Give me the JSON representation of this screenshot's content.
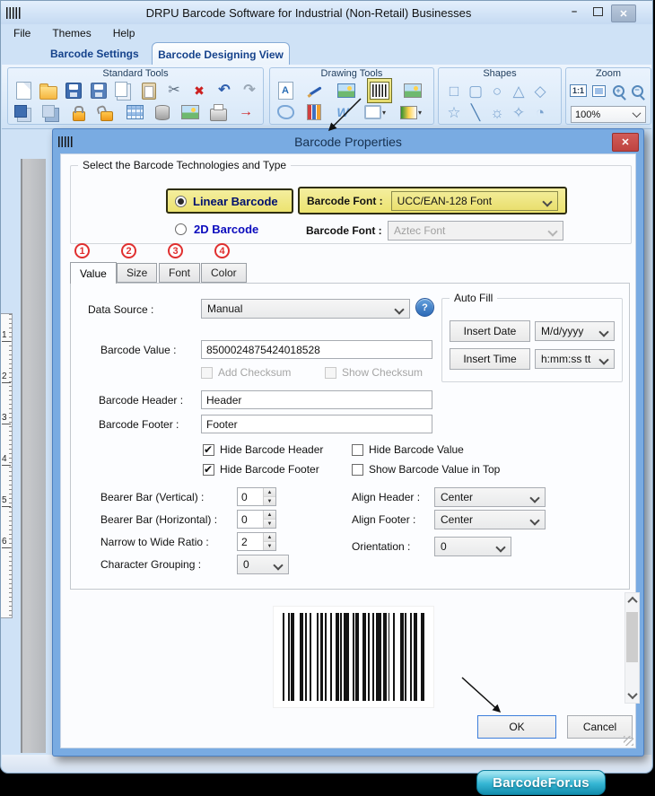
{
  "window": {
    "title": "DRPU Barcode Software for Industrial (Non-Retail) Businesses"
  },
  "menubar": {
    "items": [
      "File",
      "Themes",
      "Help"
    ]
  },
  "doc_tabs": {
    "settings": "Barcode Settings",
    "designing": "Barcode Designing View"
  },
  "ribbon": {
    "standard": {
      "label": "Standard Tools",
      "icons_row1": [
        "new-document",
        "open-file",
        "save",
        "save-as",
        "copy",
        "paste",
        "cut",
        "delete",
        "undo",
        "redo"
      ],
      "icons_row2": [
        "bring-to-front",
        "send-to-back",
        "lock",
        "unlock",
        "grid",
        "database",
        "export-image",
        "print",
        "exit"
      ]
    },
    "drawing": {
      "label": "Drawing Tools",
      "icons_row1": [
        "text-tool",
        "pencil-tool",
        "image-tool",
        "barcode-tool",
        "picture-tool"
      ],
      "icons_row2": [
        "autoshape-tool",
        "library-tool",
        "watermark-tool",
        "frame-tool",
        "gradient-tool"
      ]
    },
    "shapes": {
      "label": "Shapes",
      "icons_row1": [
        "rectangle",
        "rounded-rectangle",
        "ellipse",
        "triangle",
        "diamond"
      ],
      "icons_row2": [
        "star",
        "line",
        "starburst",
        "four-point-star",
        "pie"
      ]
    },
    "zoom": {
      "label": "Zoom",
      "actual": "1:1",
      "level": "100%"
    }
  },
  "canvas": {
    "ruler_numbers": [
      "1",
      "2",
      "3",
      "4",
      "5",
      "6"
    ]
  },
  "dialog": {
    "title": "Barcode Properties",
    "tech_group": {
      "label": "Select the Barcode Technologies and Type",
      "linear_radio": "Linear Barcode",
      "twod_radio": "2D Barcode",
      "font1_label": "Barcode Font :",
      "font1_value": "UCC/EAN-128 Font",
      "font2_label": "Barcode Font :",
      "font2_value": "Aztec Font"
    },
    "step_badges": [
      "1",
      "2",
      "3",
      "4"
    ],
    "tabs": [
      "Value",
      "Size",
      "Font",
      "Color"
    ],
    "form": {
      "data_source_label": "Data Source :",
      "data_source_value": "Manual",
      "barcode_value_label": "Barcode Value :",
      "barcode_value": "8500024875424018528",
      "add_checksum": "Add Checksum",
      "show_checksum": "Show Checksum",
      "header_label": "Barcode Header :",
      "header_value": "Header",
      "footer_label": "Barcode Footer :",
      "footer_value": "Footer",
      "hide_header": "Hide Barcode Header",
      "hide_value": "Hide Barcode Value",
      "hide_footer": "Hide Barcode Footer",
      "show_value_top": "Show Barcode Value in Top",
      "bearer_v_label": "Bearer Bar (Vertical) :",
      "bearer_v": "0",
      "bearer_h_label": "Bearer Bar (Horizontal) :",
      "bearer_h": "0",
      "ratio_label": "Narrow to Wide Ratio :",
      "ratio": "2",
      "grouping_label": "Character Grouping :",
      "grouping": "0",
      "align_header_label": "Align Header  :",
      "align_header": "Center",
      "align_footer_label": "Align Footer :",
      "align_footer": "Center",
      "orientation_label": "Orientation :",
      "orientation": "0"
    },
    "autofill": {
      "label": "Auto Fill",
      "insert_date": "Insert Date",
      "date_format": "M/d/yyyy",
      "insert_time": "Insert Time",
      "time_format": "h:mm:ss tt"
    },
    "barcode_pattern": "1211232112131121121221113211222112113121121321121122312112211232112131121",
    "ok_label": "OK",
    "cancel_label": "Cancel"
  },
  "footer": {
    "brand": "BarcodeFor.us"
  },
  "colors": {
    "highlight_yellow": "#efe88f",
    "dialog_titlebar_blue": "#74a7e0",
    "close_red": "#c9504e",
    "brand_teal": "#1ba3c5",
    "annotation_red": "#e03030"
  }
}
